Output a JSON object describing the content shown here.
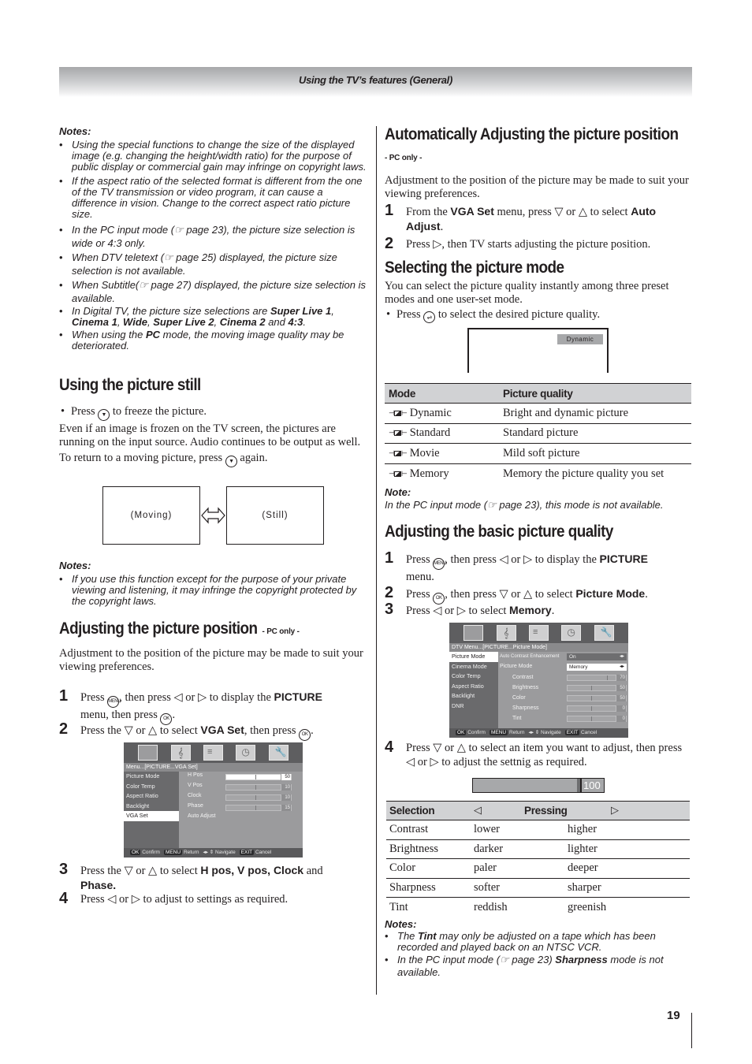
{
  "header": {
    "title": "Using the TV’s features (General)"
  },
  "left": {
    "notes_top": {
      "title": "Notes:",
      "items": [
        "Using the special functions to change the size of the displayed image (e.g. changing the height/width ratio) for the purpose of public display or commercial gain may infringe on copyright laws.",
        "If the aspect ratio of the selected format is different from the one of the TV transmission or video program, it can cause a difference in vision. Change to the correct aspect ratio picture size.",
        "In the PC input mode (☞ page 23), the picture size selection is wide or 4:3 only.",
        "When DTV teletext (☞ page 25) displayed, the picture size selection is not available.",
        "When Subtitle(☞ page 27)  displayed, the picture size selection is available."
      ],
      "item6_parts": [
        "In Digital TV, the picture size selections are ",
        "Super Live 1",
        ", ",
        "Cinema 1",
        ", ",
        "Wide",
        ", ",
        "Super Live 2",
        ", ",
        "Cinema 2",
        " and ",
        "4:3",
        "."
      ],
      "item7_parts": [
        "When using the ",
        "PC",
        " mode, the moving image quality may be deteriorated."
      ]
    },
    "still": {
      "heading": "Using the picture still",
      "bullet_pre": "Press",
      "bullet_post": "to freeze the picture.",
      "para": "Even if an image is frozen on the TV screen, the pictures are running on the input source. Audio continues to be output as well.",
      "return_pre": "To return to a moving picture, press",
      "return_post": "again.",
      "diagram": {
        "left_label": "(Moving)",
        "right_label": "(Still)",
        "arrow": "⇔"
      },
      "notes_title": "Notes:",
      "notes": [
        "If you use this function except for the purpose of your private viewing and listening, it may infringe the copyright protected by the copyright laws."
      ]
    },
    "position": {
      "heading": "Adjusting the picture position",
      "suffix": "- PC only -",
      "intro": "Adjustment to the position of the picture may be made to suit your viewing preferences.",
      "steps": [
        {
          "num": "1",
          "a": "Press",
          "b": ", then press ◁ or ▷ to display the ",
          "bold": "PICTURE",
          "c": "menu, then press",
          "d": "."
        },
        {
          "num": "2",
          "a": "Press the ▽ or △ to select ",
          "bold": "VGA Set",
          "b": ", then press",
          "c": "."
        },
        {
          "num": "3",
          "a": "Press the ▽ or △ to select ",
          "bold": "H pos, V pos, Clock",
          "b": "  and",
          "bold2": "Phase."
        },
        {
          "num": "4",
          "a": "Press ◁ or ▷ to adjust to settings as required."
        }
      ],
      "osd": {
        "path": "Menu...[PICTURE...VGA Set]",
        "left_items": [
          "Picture Mode",
          "Color Temp",
          "Aspect Ratio",
          "Backlight",
          "VGA Set"
        ],
        "selected": "VGA Set",
        "rows": [
          {
            "label": "H Pos",
            "value": "50"
          },
          {
            "label": "V Pos",
            "value": "10"
          },
          {
            "label": "Clock",
            "value": "10"
          },
          {
            "label": "Phase",
            "value": "15"
          }
        ],
        "action": "Auto Adjust",
        "footer": {
          "ok": "OK",
          "confirm": "Confirm",
          "menu": "MENU",
          "return": "Return",
          "nav_icon": "◂▸ ⇕",
          "navigate": "Navigate",
          "exit": "EXIT",
          "cancel": "Cancel"
        }
      }
    }
  },
  "right": {
    "auto": {
      "heading": "Automatically Adjusting the picture position",
      "suffix": "- PC only -",
      "intro": "Adjustment to the position of the picture may be made to suit your viewing preferences.",
      "step1": {
        "num": "1",
        "a": "From the ",
        "b1": "VGA Set",
        "c": " menu, press ▽ or △ to select ",
        "b2": "Auto",
        "b3": "Adjust",
        "d": "."
      },
      "step2": {
        "num": "2",
        "text": "Press  ▷, then TV starts adjusting the picture position."
      }
    },
    "mode": {
      "heading": "Selecting the picture mode",
      "intro": "You can select the picture quality instantly among three preset modes and one user-set mode.",
      "bullet_pre": "Press",
      "bullet_post": "to select the desired picture quality.",
      "screen_chip": "Dynamic",
      "table": {
        "headers": [
          "Mode",
          "Picture quality"
        ],
        "rows": [
          [
            "Dynamic",
            "Bright and dynamic picture"
          ],
          [
            "Standard",
            "Standard picture"
          ],
          [
            "Movie",
            "Mild soft picture"
          ],
          [
            "Memory",
            "Memory the picture quality you set"
          ]
        ]
      },
      "note_title": "Note:",
      "note": "In the PC input mode (☞  page 23), this mode is not available."
    },
    "basic": {
      "heading": "Adjusting the basic picture quality",
      "step1": {
        "num": "1",
        "a": "Press",
        "b": ", then press ◁ or ▷ to display the ",
        "bold": "PICTURE",
        "c": "menu."
      },
      "step2": {
        "num": "2",
        "a": "Press",
        "b": ", then press ▽ or △ to select ",
        "bold": "Picture Mode",
        "c": "."
      },
      "step3": {
        "num": "3",
        "a": "Press ◁ or ▷ to select ",
        "bold": "Memory",
        "c": "."
      },
      "step4": {
        "num": "4",
        "a": "Press ▽ or △ to select an item you want to adjust, then press ◁ or ▷ to adjust the settnig as required."
      },
      "osd": {
        "path": "DTV Menu...[PICTURE...Picture Mode]",
        "left_items": [
          "Picture Mode",
          "Cinema Mode",
          "Color Temp",
          "Aspect Ratio",
          "Backlight",
          "DNR"
        ],
        "selected": "Picture Mode",
        "ace_label": "Auto Contrast Enhancement",
        "ace_value": "On",
        "pm_label": "Picture Mode",
        "pm_value": "Memory",
        "rows": [
          {
            "label": "Contrast",
            "value": "70"
          },
          {
            "label": "Brightness",
            "value": "50"
          },
          {
            "label": "Color",
            "value": "50"
          },
          {
            "label": "Sharpness",
            "value": "0"
          },
          {
            "label": "Tint",
            "value": "0"
          }
        ],
        "footer": {
          "ok": "OK",
          "confirm": "Confirm",
          "menu": "MENU",
          "return": "Return",
          "nav_icon": "◂▸ ⇕",
          "navigate": "Navigate",
          "exit": "EXIT",
          "cancel": "Cancel"
        }
      },
      "slider_value": "100",
      "table": {
        "headers": [
          "Selection",
          "◁",
          "Pressing",
          "▷"
        ],
        "rows": [
          [
            "Contrast",
            "lower",
            "higher"
          ],
          [
            "Brightness",
            "darker",
            "lighter"
          ],
          [
            "Color",
            "paler",
            "deeper"
          ],
          [
            "Sharpness",
            "softer",
            "sharper"
          ],
          [
            "Tint",
            "reddish",
            "greenish"
          ]
        ]
      },
      "notes_title": "Notes:",
      "note1_parts": [
        "The ",
        "Tint",
        " may only be adjusted on a tape which has been recorded and played back on an NTSC VCR."
      ],
      "note2_parts": [
        "In the PC input mode (☞ page 23) ",
        "Sharpness",
        " mode is not available."
      ]
    }
  },
  "footer": {
    "page_number": "19"
  },
  "buttons": {
    "menu": "MENU",
    "ok": "OK"
  }
}
